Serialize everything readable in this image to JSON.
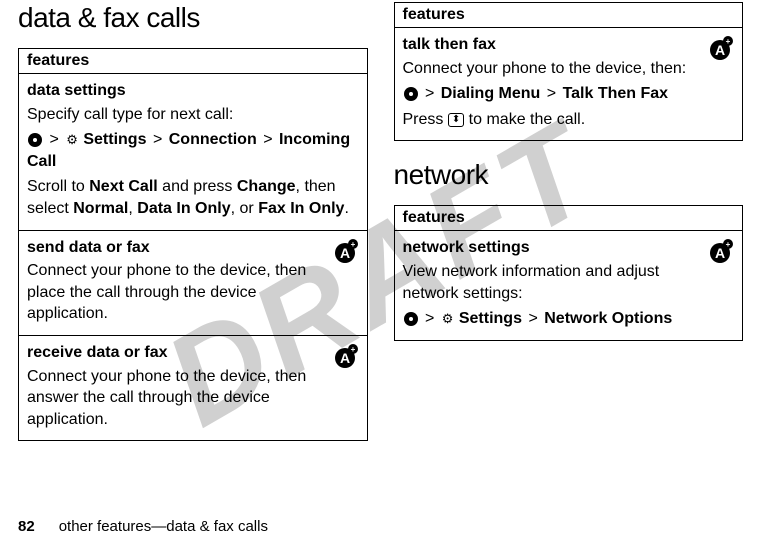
{
  "watermark": "DRAFT",
  "heading_left": "data & fax calls",
  "heading_right": "network",
  "table_header": "features",
  "gt": ">",
  "left": {
    "data_settings": {
      "title": "data settings",
      "desc": "Specify call type for next call:",
      "settings": "Settings",
      "connection": "Connection",
      "incoming": "Incoming Call",
      "scroll1": "Scroll to ",
      "next_call": "Next Call",
      "scroll2": " and press ",
      "change": "Change",
      "scroll3": ", then select ",
      "normal": "Normal",
      "comma": ", ",
      "data_only": "Data In Only",
      "or": ", or ",
      "fax_only": "Fax In Only",
      "period": "."
    },
    "send": {
      "title": "send data or fax",
      "desc": "Connect your phone to the device, then place the call through the device application."
    },
    "receive": {
      "title": "receive data or fax",
      "desc": "Connect your phone to the device, then answer the call through the device application."
    }
  },
  "right_top": {
    "talk": {
      "title": "talk then fax",
      "desc": "Connect your phone to the device, then:",
      "dialing": "Dialing Menu",
      "ttf": "Talk Then Fax",
      "press1": "Press ",
      "press2": " to make the call."
    }
  },
  "right_bottom": {
    "net": {
      "title": "network settings",
      "desc": "View network information and adjust network settings:",
      "settings": "Settings",
      "netopt": "Network Options"
    }
  },
  "footer": {
    "page": "82",
    "text": "other features—data & fax calls"
  }
}
